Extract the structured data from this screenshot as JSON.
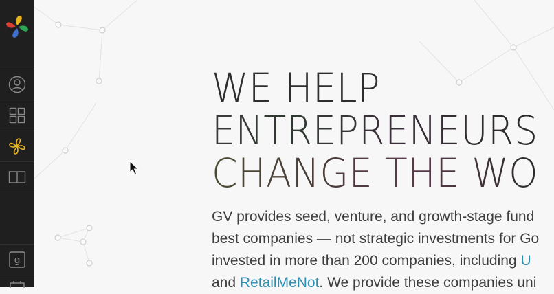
{
  "sidebar": {
    "items": [
      {
        "icon": "user-circle-icon"
      },
      {
        "icon": "grid-icon"
      },
      {
        "icon": "gv-logo-mark-icon",
        "active_color": "#e6b325"
      },
      {
        "icon": "book-icon"
      },
      {
        "icon": "google-g-icon"
      },
      {
        "icon": "calendar-icon"
      }
    ]
  },
  "hero": {
    "headline": [
      "WE HELP",
      "ENTREPRENEURS",
      "CHANGE THE WO"
    ],
    "intro": {
      "line1": "GV provides seed, venture, and growth-stage fund",
      "line2": "best companies — not strategic investments for Go",
      "line3_start": "invested in more than 200 companies, including ",
      "line3_link": "U",
      "line4_start": "and ",
      "line4_link": "RetailMeNot",
      "line4_end": ". We provide these companies uni"
    }
  },
  "colors": {
    "sidebar_bg": "#1f1f1f",
    "page_bg": "#f7f7f7",
    "link": "#2d8fb0",
    "accent_yellow": "#e6b325"
  }
}
